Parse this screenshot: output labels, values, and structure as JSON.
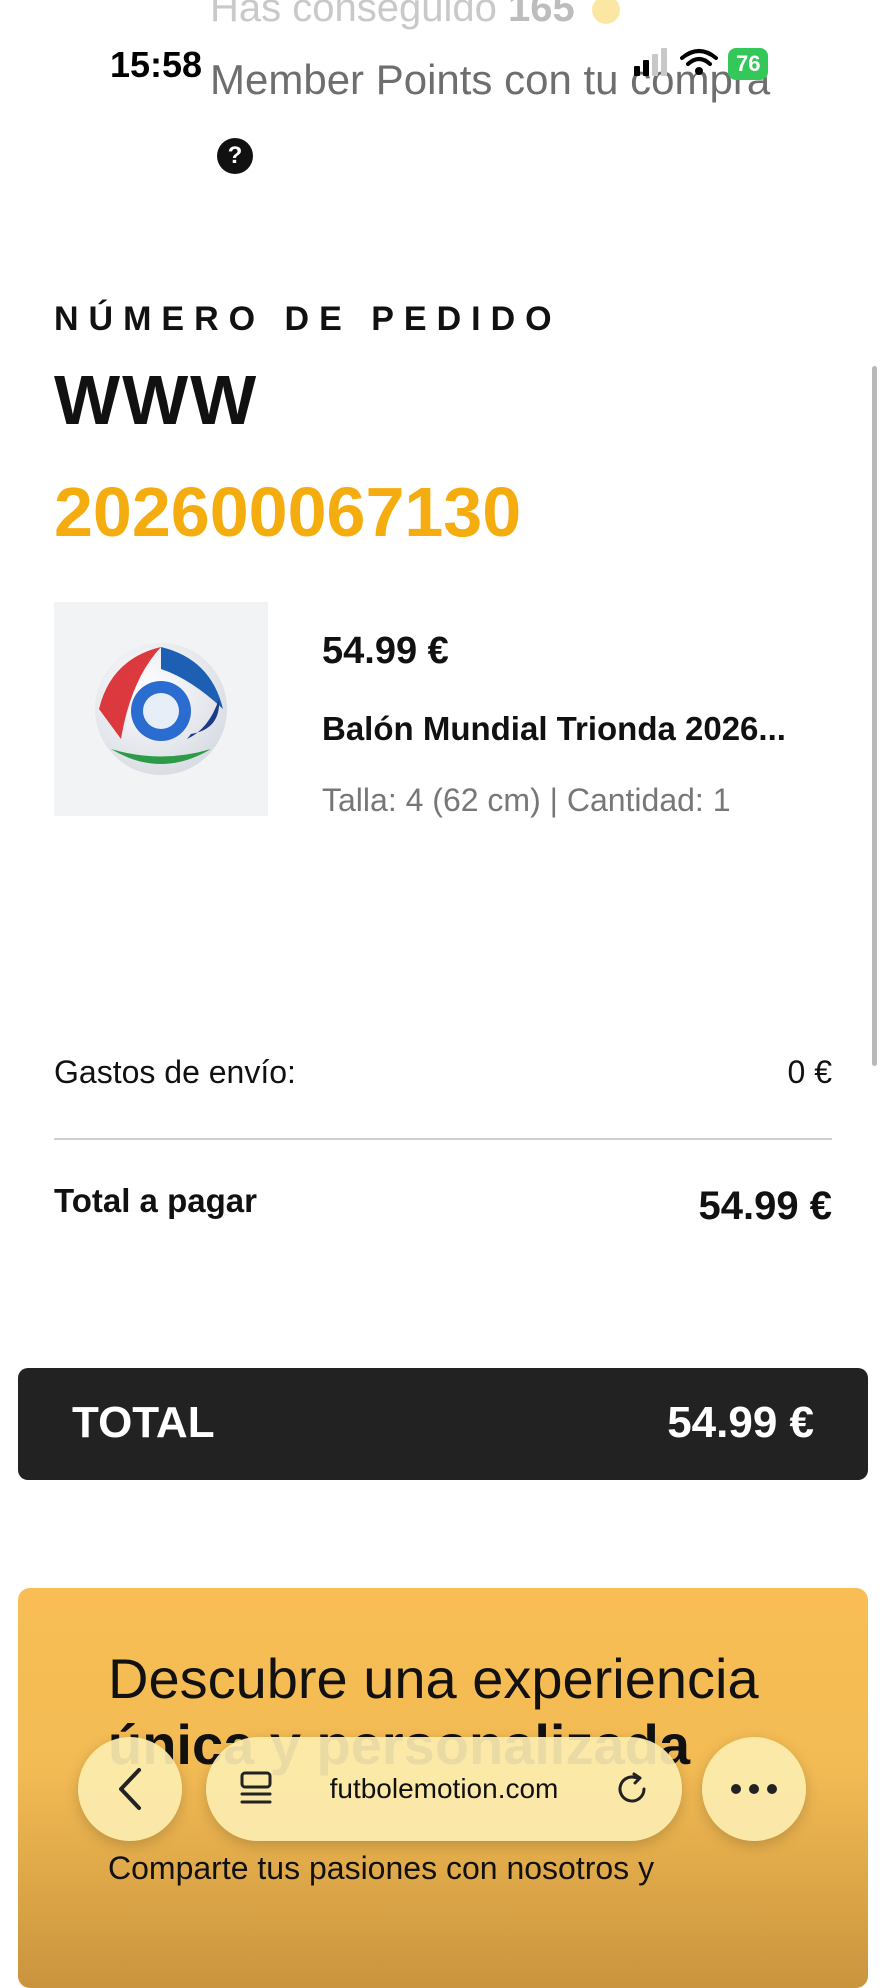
{
  "overlay": {
    "points_line1_prefix": "Has conseguido",
    "points_value": "165",
    "points_line2": "Member Points con tu compra"
  },
  "status_bar": {
    "time": "15:58",
    "battery": "76"
  },
  "order": {
    "label": "NÚMERO DE PEDIDO",
    "prefix": "WWW",
    "number": "202600067130"
  },
  "product": {
    "price": "54.99 €",
    "name": "Balón Mundial Trionda 2026...",
    "meta": "Talla: 4 (62 cm) | Cantidad: 1"
  },
  "summary": {
    "shipping_label": "Gastos de envío:",
    "shipping_value": "0 €",
    "total_pay_label": "Total a pagar",
    "total_pay_value": "54.99 €"
  },
  "total_bar": {
    "label": "TOTAL",
    "value": "54.99 €"
  },
  "promo": {
    "title_regular": "Descubre una experiencia",
    "title_bold": "única y personalizada",
    "subtitle": "Comparte tus pasiones con nosotros y"
  },
  "browser": {
    "url": "futbolemotion.com"
  },
  "colors": {
    "accent_orange": "#f5ac0f",
    "total_bar_bg": "#222222",
    "promo_bg": "#f8be55",
    "battery_green": "#34c759"
  }
}
